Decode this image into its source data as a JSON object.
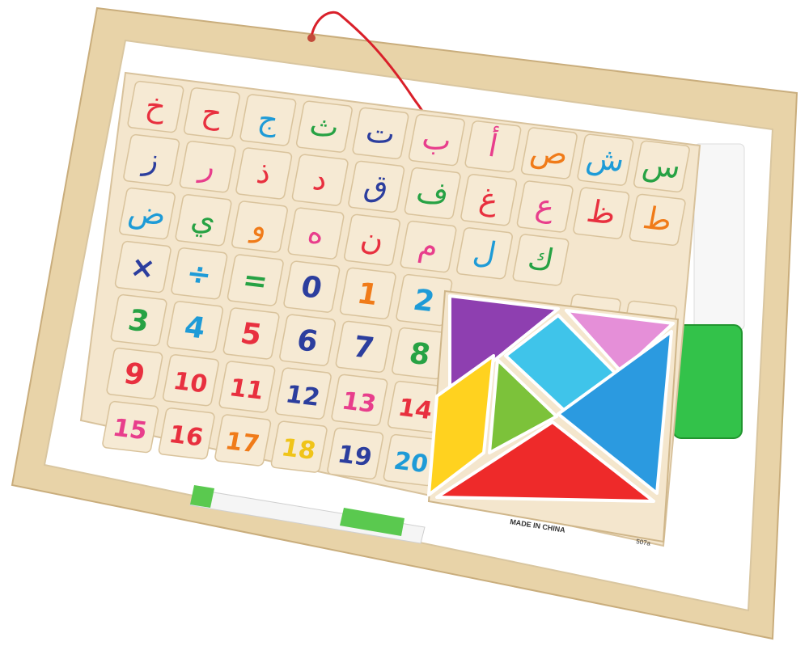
{
  "board": {
    "frame_color": "#ead7b2",
    "board_color": "#ffffff",
    "puzzle_color": "#f4e6cd"
  },
  "letter_rows": [
    [
      {
        "text": "خ",
        "color": "#e8303f"
      },
      {
        "text": "ح",
        "color": "#e8303f"
      },
      {
        "text": "ج",
        "color": "#1e9bd7"
      },
      {
        "text": "ث",
        "color": "#27a244"
      },
      {
        "text": "ت",
        "color": "#2c3e9e"
      },
      {
        "text": "ب",
        "color": "#e83e8c"
      },
      {
        "text": "أ",
        "color": "#e83e8c"
      },
      {
        "text": "ص",
        "color": "#f07b19"
      },
      {
        "text": "ش",
        "color": "#1e9bd7"
      },
      {
        "text": "س",
        "color": "#27a244"
      }
    ],
    [
      {
        "text": "ز",
        "color": "#2c3e9e"
      },
      {
        "text": "ر",
        "color": "#e83e8c"
      },
      {
        "text": "ذ",
        "color": "#e8303f"
      },
      {
        "text": "د",
        "color": "#e8303f"
      },
      {
        "text": "ق",
        "color": "#2c3e9e"
      },
      {
        "text": "ف",
        "color": "#27a244"
      },
      {
        "text": "غ",
        "color": "#e8303f"
      },
      {
        "text": "ع",
        "color": "#e83e8c"
      },
      {
        "text": "ظ",
        "color": "#e8303f"
      },
      {
        "text": "ط",
        "color": "#f07b19"
      }
    ],
    [
      {
        "text": "ض",
        "color": "#1e9bd7"
      },
      {
        "text": "ي",
        "color": "#27a244"
      },
      {
        "text": "و",
        "color": "#f07b19"
      },
      {
        "text": "ه",
        "color": "#e83e8c"
      },
      {
        "text": "ن",
        "color": "#e8303f"
      },
      {
        "text": "م",
        "color": "#e83e8c"
      },
      {
        "text": "ل",
        "color": "#1e9bd7"
      },
      {
        "text": "ك",
        "color": "#27a244"
      }
    ]
  ],
  "symbol_row": [
    {
      "text": "×",
      "color": "#2c3e9e"
    },
    {
      "text": "÷",
      "color": "#1e9bd7"
    },
    {
      "text": "=",
      "color": "#27a244"
    },
    {
      "text": "0",
      "color": "#2c3e9e"
    },
    {
      "text": "1",
      "color": "#f07b19"
    },
    {
      "text": "2",
      "color": "#1e9bd7"
    },
    {
      "text": "+",
      "color": "#e8303f"
    },
    {
      "text": "−",
      "color": "#e8303f"
    }
  ],
  "number_rows": [
    [
      {
        "text": "3",
        "color": "#27a244"
      },
      {
        "text": "4",
        "color": "#1e9bd7"
      },
      {
        "text": "5",
        "color": "#e8303f"
      },
      {
        "text": "6",
        "color": "#2c3e9e"
      },
      {
        "text": "7",
        "color": "#2c3e9e"
      },
      {
        "text": "8",
        "color": "#27a244"
      }
    ],
    [
      {
        "text": "9",
        "color": "#e8303f"
      },
      {
        "text": "10",
        "color": "#e8303f"
      },
      {
        "text": "11",
        "color": "#e8303f"
      },
      {
        "text": "12",
        "color": "#2c3e9e"
      },
      {
        "text": "13",
        "color": "#e83e8c"
      },
      {
        "text": "14",
        "color": "#e8303f"
      }
    ],
    [
      {
        "text": "15",
        "color": "#e83e8c"
      },
      {
        "text": "16",
        "color": "#e8303f"
      },
      {
        "text": "17",
        "color": "#f07b19"
      },
      {
        "text": "18",
        "color": "#f0c419"
      },
      {
        "text": "19",
        "color": "#2c3e9e"
      },
      {
        "text": "20",
        "color": "#1e9bd7"
      }
    ]
  ],
  "tangram_colors": {
    "purple": "#8e3fb0",
    "pink": "#e58fd8",
    "cyan": "#3fc4ea",
    "yellow": "#ffd21f",
    "green": "#7cc23a",
    "blue": "#2b9ae0",
    "red": "#ee2a2a"
  },
  "imprint": {
    "made_in": "MADE IN CHINA",
    "model": "507a"
  },
  "accessories": {
    "eraser_color": "#33c24a",
    "marker_cap_color": "#5ac94f",
    "string_color": "#d9202a"
  }
}
